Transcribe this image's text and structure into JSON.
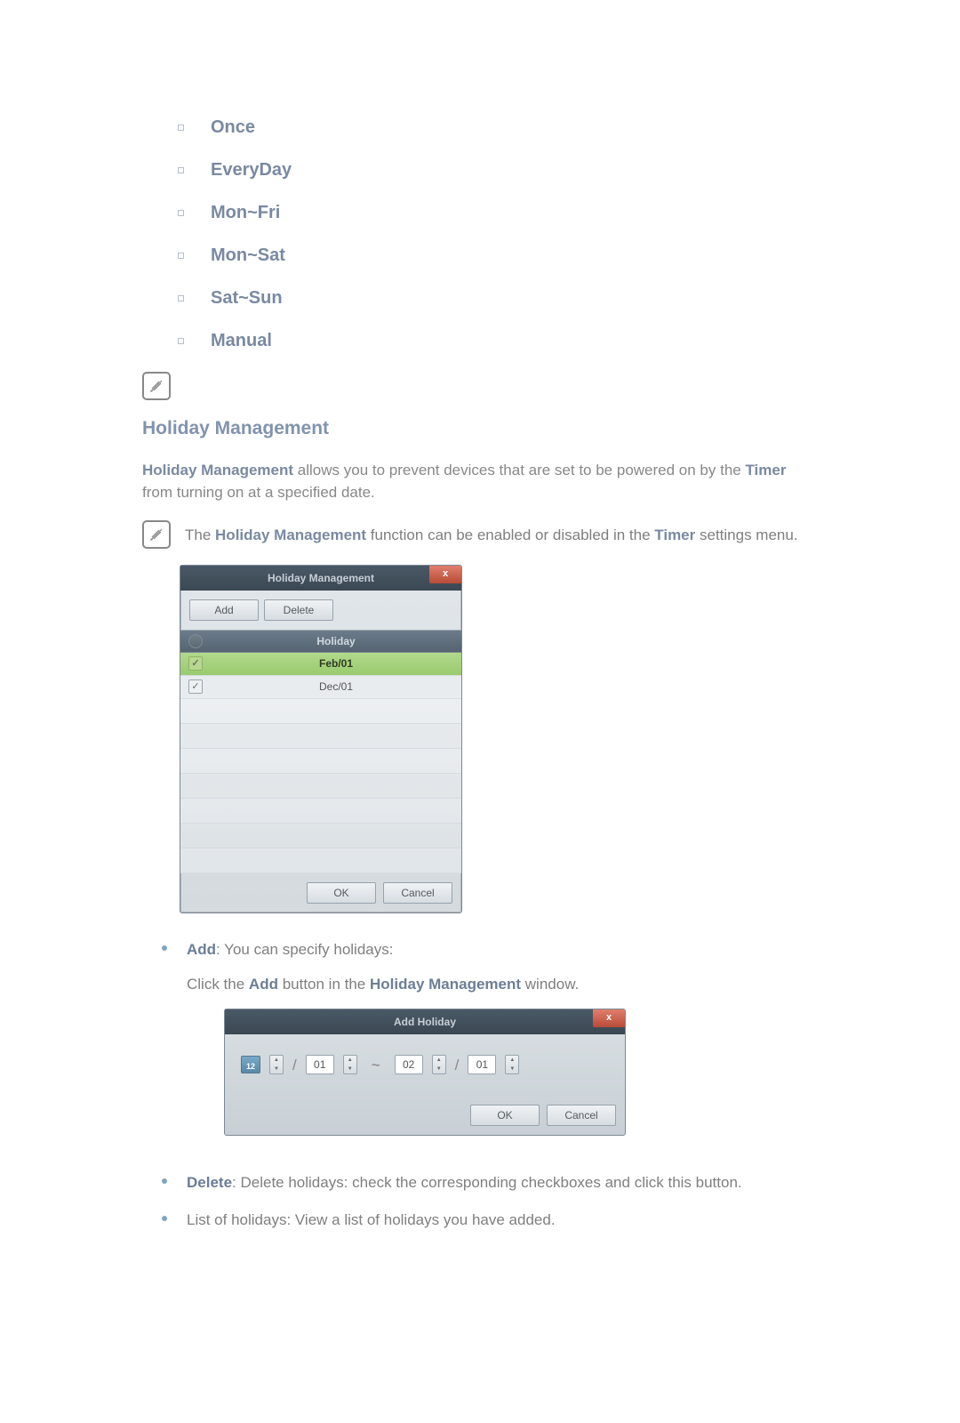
{
  "options": {
    "items": [
      "Once",
      "EveryDay",
      "Mon~Fri",
      "Mon~Sat",
      "Sat~Sun",
      "Manual"
    ]
  },
  "section": {
    "title": "Holiday Management",
    "intro_pre": "Holiday Management",
    "intro_rest": " allows you to prevent devices that are set to be powered on by the ",
    "intro_bold2": "Timer",
    "intro_tail": " from turning on at a specified date.",
    "note_pre": "The ",
    "note_bold1": "Holiday Management",
    "note_mid": " function can be enabled or disabled in the ",
    "note_bold2": "Timer",
    "note_tail": " settings menu."
  },
  "hm_dialog": {
    "title": "Holiday Management",
    "close": "x",
    "add": "Add",
    "delete": "Delete",
    "col_header": "Holiday",
    "rows": [
      {
        "checked": true,
        "label": "Feb/01"
      },
      {
        "checked": true,
        "label": "Dec/01"
      }
    ],
    "ok": "OK",
    "cancel": "Cancel"
  },
  "add_section": {
    "label": "Add",
    "desc": ": You can specify holidays:",
    "hint_pre": "Click the ",
    "hint_b1": "Add",
    "hint_mid": " button in the ",
    "hint_b2": "Holiday Management",
    "hint_tail": " window."
  },
  "ah_dialog": {
    "title": "Add Holiday",
    "close": "x",
    "cal": "12",
    "m1": "01",
    "d1": "02",
    "m2": "01",
    "tilde": "~",
    "slash": "/",
    "ok": "OK",
    "cancel": "Cancel"
  },
  "delete_item": {
    "label": "Delete",
    "desc": ": Delete holidays: check the corresponding checkboxes and click this button."
  },
  "list_item": {
    "desc": "List of holidays: View a list of holidays you have added."
  }
}
